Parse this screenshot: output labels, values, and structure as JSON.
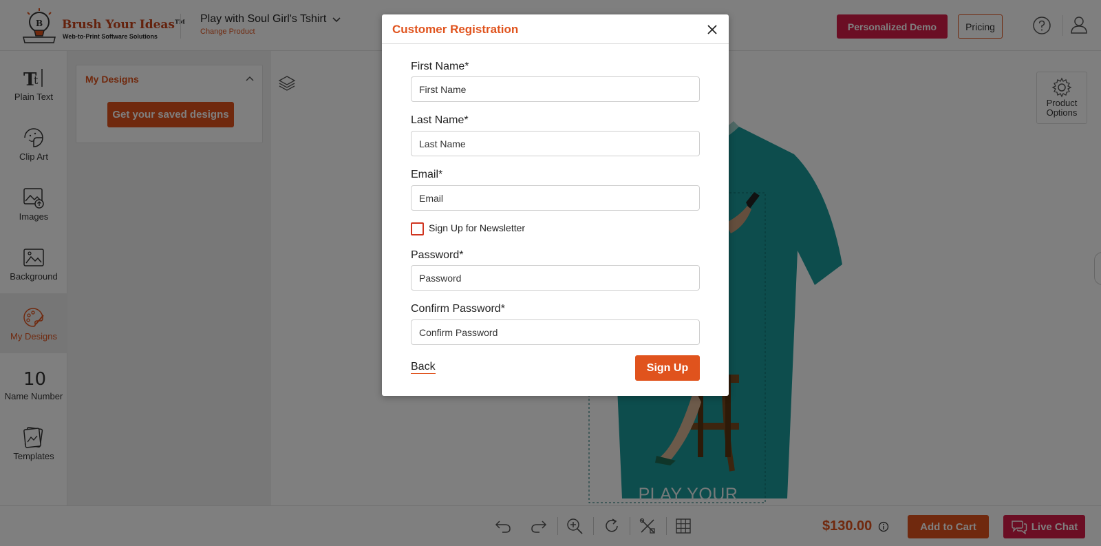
{
  "header": {
    "brand_name": "Brush Your Ideas",
    "brand_trademark": "TM",
    "brand_tagline": "Web-to-Print Software Solutions",
    "product_title": "Play with Soul Girl's Tshirt",
    "change_product": "Change Product",
    "demo_button": "Personalized Demo",
    "pricing_button": "Pricing"
  },
  "toolbar": {
    "items": [
      {
        "label": "Plain Text",
        "icon": "text-icon"
      },
      {
        "label": "Clip Art",
        "icon": "clipart-icon"
      },
      {
        "label": "Images",
        "icon": "image-upload-icon"
      },
      {
        "label": "Background",
        "icon": "background-icon"
      },
      {
        "label": "My Designs",
        "icon": "palette-icon"
      },
      {
        "label": "Name Number",
        "icon": "name-number-icon"
      },
      {
        "label": "Templates",
        "icon": "templates-icon"
      }
    ],
    "name_number_glyph": "10"
  },
  "panel": {
    "title": "My Designs",
    "saved_button": "Get your saved designs"
  },
  "canvas": {
    "product_options": "Product Options",
    "print_text": "PLAY YOUR SOUL",
    "shirt_color": "#1b9a9a"
  },
  "bottom_bar": {
    "price": "$130.00",
    "add_to_cart": "Add to Cart",
    "live_chat": "Live Chat"
  },
  "modal": {
    "title": "Customer Registration",
    "first_name_label": "First Name*",
    "first_name_placeholder": "First Name",
    "last_name_label": "Last Name*",
    "last_name_placeholder": "Last Name",
    "email_label": "Email*",
    "email_placeholder": "Email",
    "newsletter_label": "Sign Up for Newsletter",
    "password_label": "Password*",
    "password_placeholder": "Password",
    "confirm_password_label": "Confirm Password*",
    "confirm_password_placeholder": "Confirm Password",
    "back_link": "Back",
    "signup_button": "Sign Up"
  },
  "colors": {
    "accent": "#e0531d",
    "brand_red": "#d71d49"
  }
}
